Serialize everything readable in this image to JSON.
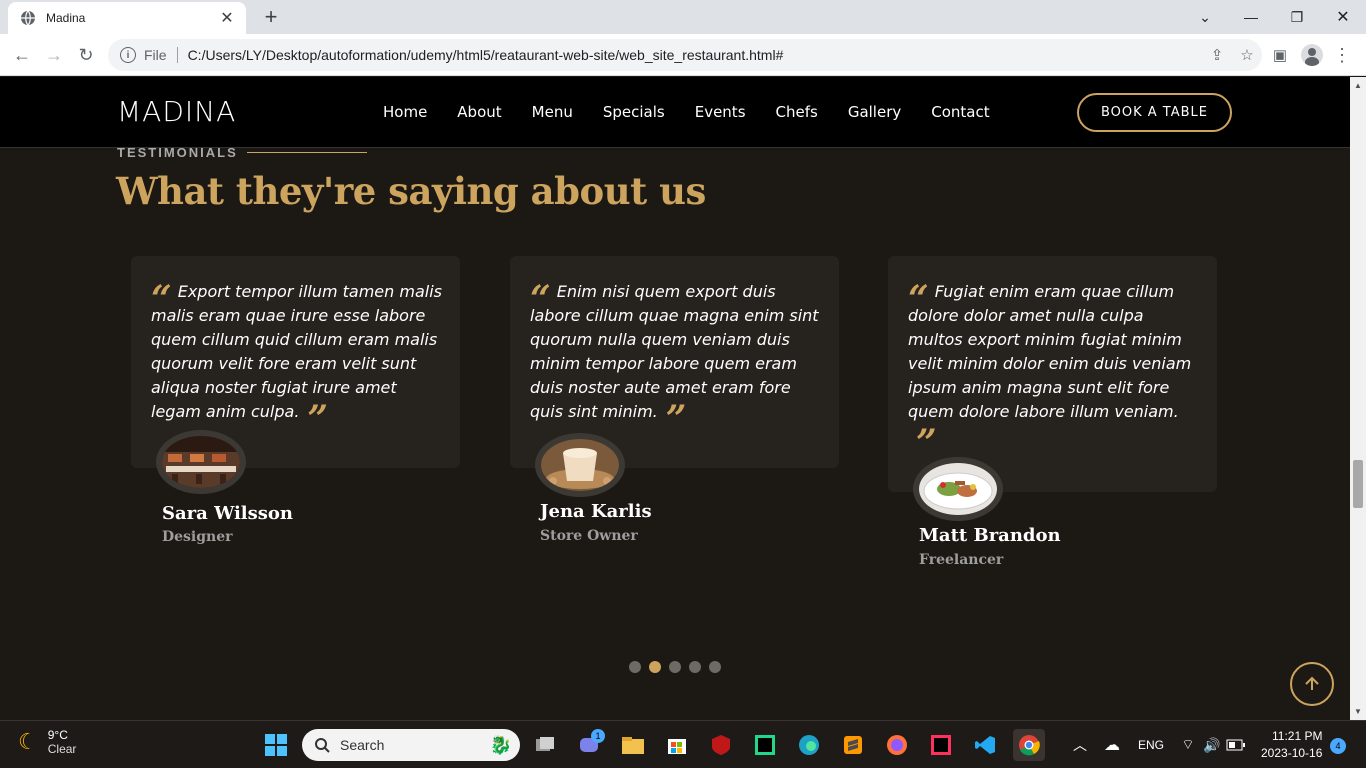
{
  "browser": {
    "tab_title": "Madina",
    "address_scheme": "File",
    "url": "C:/Users/LY/Desktop/autoformation/udemy/html5/reataurant-web-site/web_site_restaurant.html#"
  },
  "site": {
    "logo": "MADINA",
    "nav": [
      {
        "label": "Home"
      },
      {
        "label": "About"
      },
      {
        "label": "Menu"
      },
      {
        "label": "Specials"
      },
      {
        "label": "Events"
      },
      {
        "label": "Chefs"
      },
      {
        "label": "Gallery"
      },
      {
        "label": "Contact"
      }
    ],
    "book_button": "BOOK A TABLE"
  },
  "testimonials": {
    "label": "TESTIMONIALS",
    "title": "What they're saying about us",
    "items": [
      {
        "quote": "Export tempor illum tamen malis malis eram quae irure esse labore quem cillum quid cillum eram malis quorum velit fore eram velit sunt aliqua noster fugiat irure amet legam anim culpa.",
        "name": "Sara Wilsson",
        "role": "Designer",
        "photo": "restaurant-interior"
      },
      {
        "quote": "Enim nisi quem export duis labore cillum quae magna enim sint quorum nulla quem veniam duis minim tempor labore quem eram duis noster aute amet eram fore quis sint minim.",
        "name": "Jena Karlis",
        "role": "Store Owner",
        "photo": "dessert-cup"
      },
      {
        "quote": "Fugiat enim eram quae cillum dolore dolor amet nulla culpa multos export minim fugiat minim velit minim dolor enim duis veniam ipsum anim magna sunt elit fore quem dolore labore illum veniam.",
        "name": "Matt Brandon",
        "role": "Freelancer",
        "photo": "salad-plate"
      }
    ],
    "pagination": {
      "count": 5,
      "active": 2
    }
  },
  "taskbar": {
    "weather_temp": "9°C",
    "weather_desc": "Clear",
    "search_placeholder": "Search",
    "teams_badge": "1",
    "lang": "ENG",
    "time": "11:21 PM",
    "date": "2023-10-16",
    "notif_count": "4"
  },
  "colors": {
    "accent": "#cda45e",
    "page_bg": "#1c1814",
    "card_bg": "#26221d"
  }
}
